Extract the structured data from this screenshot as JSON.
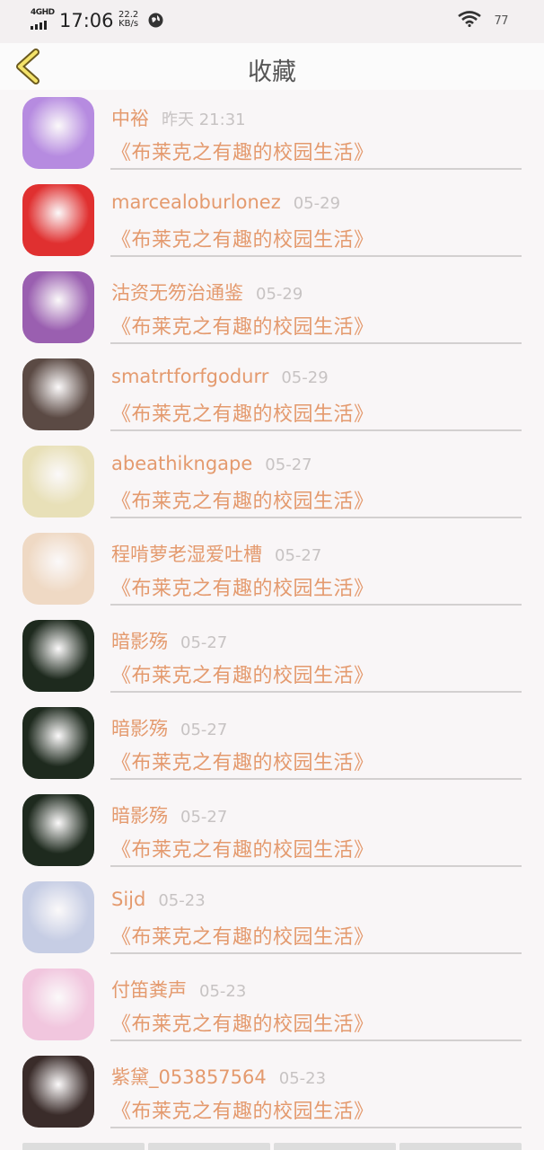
{
  "status_bar": {
    "network": "4GHD",
    "time": "17:06",
    "speed_value": "22.2",
    "speed_unit": "KB/s",
    "battery": "77"
  },
  "header": {
    "title": "收藏"
  },
  "items": [
    {
      "user": "中裕",
      "date": "昨天 21:31",
      "book": "《布莱克之有趣的校园生活》",
      "avatar_color": "#b68be0"
    },
    {
      "user": "marcealoburlonez",
      "date": "05-29",
      "book": "《布莱克之有趣的校园生活》",
      "avatar_color": "#e03030"
    },
    {
      "user": "沽资无笏治通鉴",
      "date": "05-29",
      "book": "《布莱克之有趣的校园生活》",
      "avatar_color": "#9a5fb0"
    },
    {
      "user": "smatrtforfgodurr",
      "date": "05-29",
      "book": "《布莱克之有趣的校园生活》",
      "avatar_color": "#5b4a44"
    },
    {
      "user": "abeathikngape",
      "date": "05-27",
      "book": "《布莱克之有趣的校园生活》",
      "avatar_color": "#e8e0b8"
    },
    {
      "user": "程啃萝老湿爱吐槽",
      "date": "05-27",
      "book": "《布莱克之有趣的校园生活》",
      "avatar_color": "#efd9c4"
    },
    {
      "user": "暗影殇",
      "date": "05-27",
      "book": "《布莱克之有趣的校园生活》",
      "avatar_color": "#1e2a1e"
    },
    {
      "user": "暗影殇",
      "date": "05-27",
      "book": "《布莱克之有趣的校园生活》",
      "avatar_color": "#1e2a1e"
    },
    {
      "user": "暗影殇",
      "date": "05-27",
      "book": "《布莱克之有趣的校园生活》",
      "avatar_color": "#1e2a1e"
    },
    {
      "user": "Sijd",
      "date": "05-23",
      "book": "《布莱克之有趣的校园生活》",
      "avatar_color": "#c6cde4"
    },
    {
      "user": "付笛粪声",
      "date": "05-23",
      "book": "《布莱克之有趣的校园生活》",
      "avatar_color": "#f1c6de"
    },
    {
      "user": "紫黛_053857564",
      "date": "05-23",
      "book": "《布莱克之有趣的校园生活》",
      "avatar_color": "#3a2c2a"
    }
  ]
}
